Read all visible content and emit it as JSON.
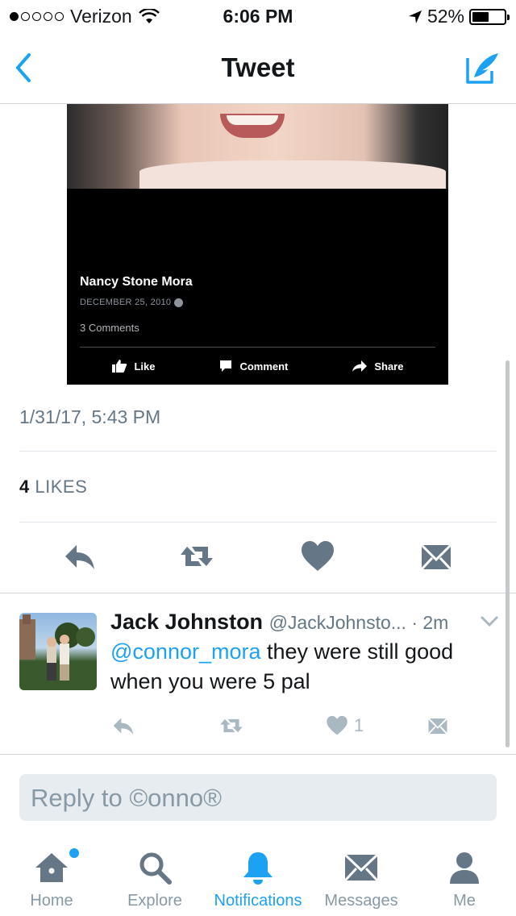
{
  "status_bar": {
    "carrier": "Verizon",
    "time": "6:06 PM",
    "battery": "52%",
    "battery_level": 0.52,
    "signal_bars_filled": 1,
    "signal_bars_total": 5
  },
  "nav": {
    "title": "Tweet",
    "back_icon": "chevron-left-icon",
    "compose_icon": "compose-tweet-icon"
  },
  "embedded_post": {
    "author": "Nancy Stone Mora",
    "date": "DECEMBER 25, 2010",
    "comments": "3 Comments",
    "like_label": "Like",
    "comment_label": "Comment",
    "share_label": "Share"
  },
  "tweet": {
    "timestamp": "1/31/17, 5:43 PM",
    "likes_count": "4",
    "likes_label": "LIKES"
  },
  "reply": {
    "name": "Jack Johnston",
    "handle_time": "@JackJohnsto... · 2m",
    "mention": "@connor_mora",
    "text": " they were still good when you were 5 pal",
    "like_count": "1"
  },
  "reply_box": {
    "placeholder": "Reply to ©onno®"
  },
  "tabs": [
    {
      "label": "Home",
      "icon": "home-icon"
    },
    {
      "label": "Explore",
      "icon": "search-icon"
    },
    {
      "label": "Notifications",
      "icon": "bell-icon"
    },
    {
      "label": "Messages",
      "icon": "envelope-icon"
    },
    {
      "label": "Me",
      "icon": "person-icon"
    }
  ],
  "colors": {
    "accent": "#1da1f2",
    "muted": "#657786",
    "icon_gray": "#657786",
    "light_icon": "#aab8c2"
  }
}
